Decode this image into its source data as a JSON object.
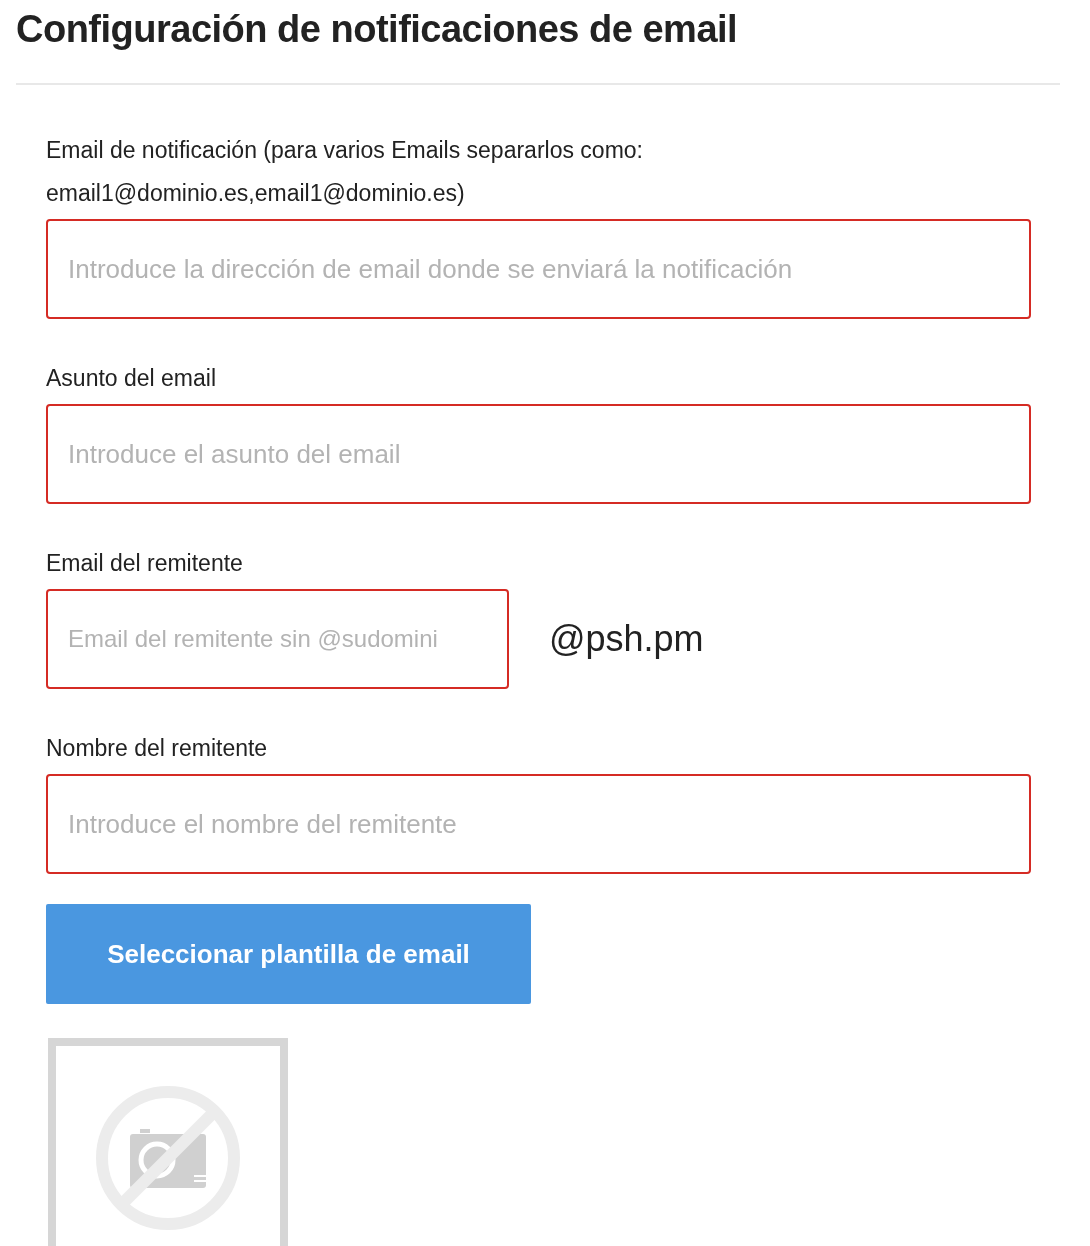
{
  "title": "Configuración de notificaciones de email",
  "fields": [
    {
      "label": "Email de notificación (para varios Emails separarlos como: email1@dominio.es,email1@dominio.es)",
      "placeholder": "Introduce la dirección de email donde se enviará la notificación",
      "invalid": true
    },
    {
      "label": "Asunto del email",
      "placeholder": "Introduce el asunto del email",
      "invalid": true
    },
    {
      "label": "Email del remitente",
      "placeholder": "Email del remitente sin @sudomini",
      "invalid": true,
      "suffix": "@psh.pm"
    },
    {
      "label": "Nombre del remitente",
      "placeholder": "Introduce el nombre del remitente",
      "invalid": true
    }
  ],
  "button": "Seleccionar plantilla de email"
}
